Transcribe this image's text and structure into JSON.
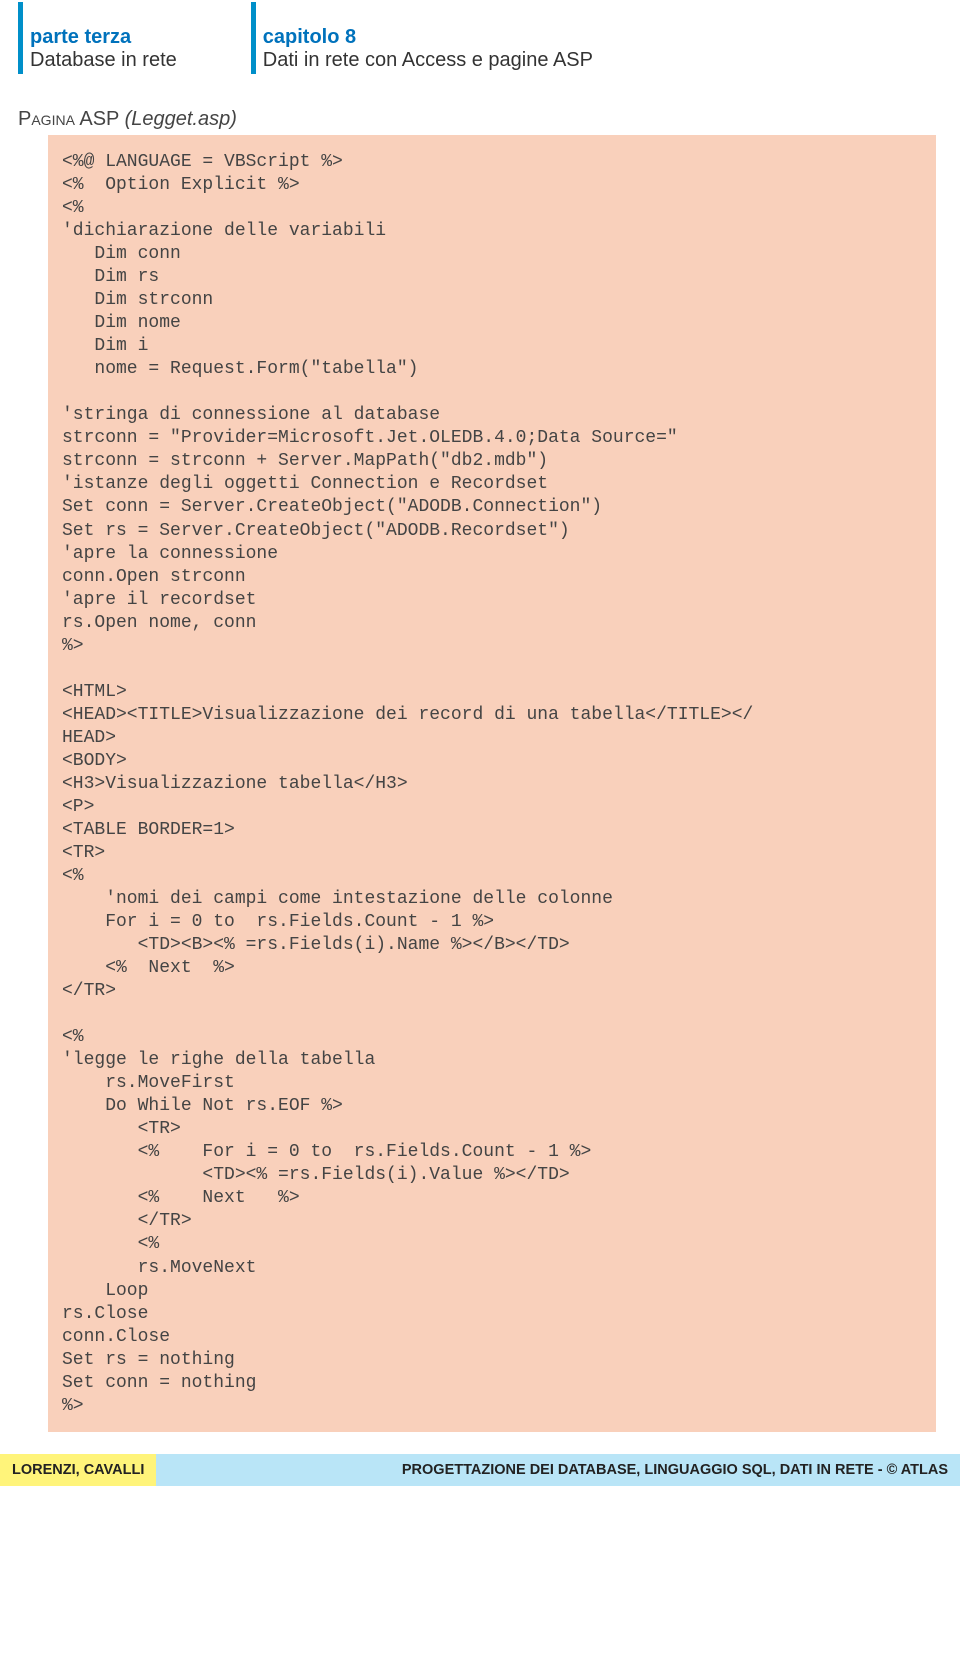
{
  "header": {
    "left_title": "parte terza",
    "left_sub": "Database in rete",
    "right_title": "capitolo 8",
    "right_sub": "Dati in rete con Access e pagine ASP"
  },
  "pagina_prefix": "Pagina",
  "pagina_asp": " ASP ",
  "pagina_file": "(Legget.asp)",
  "code": "<%@ LANGUAGE = VBScript %>\n<%  Option Explicit %>\n<%\n'dichiarazione delle variabili\n   Dim conn\n   Dim rs\n   Dim strconn\n   Dim nome\n   Dim i\n   nome = Request.Form(\"tabella\")\n\n'stringa di connessione al database\nstrconn = \"Provider=Microsoft.Jet.OLEDB.4.0;Data Source=\"\nstrconn = strconn + Server.MapPath(\"db2.mdb\")\n'istanze degli oggetti Connection e Recordset\nSet conn = Server.CreateObject(\"ADODB.Connection\")\nSet rs = Server.CreateObject(\"ADODB.Recordset\")\n'apre la connessione\nconn.Open strconn\n'apre il recordset\nrs.Open nome, conn\n%>\n\n<HTML>\n<HEAD><TITLE>Visualizzazione dei record di una tabella</TITLE></\nHEAD>\n<BODY>\n<H3>Visualizzazione tabella</H3>\n<P>\n<TABLE BORDER=1>\n<TR>\n<%\n    'nomi dei campi come intestazione delle colonne\n    For i = 0 to  rs.Fields.Count - 1 %>\n       <TD><B><% =rs.Fields(i).Name %></B></TD>\n    <%  Next  %>\n</TR>\n\n<%\n'legge le righe della tabella\n    rs.MoveFirst\n    Do While Not rs.EOF %>\n       <TR>\n       <%    For i = 0 to  rs.Fields.Count - 1 %>\n             <TD><% =rs.Fields(i).Value %></TD>\n       <%    Next   %>\n       </TR>\n       <%\n       rs.MoveNext\n    Loop\nrs.Close\nconn.Close\nSet rs = nothing\nSet conn = nothing\n%>",
  "footer": {
    "left": "LORENZI, CAVALLI",
    "right": "PROGETTAZIONE DEI DATABASE, LINGUAGGIO SQL, DATI IN RETE - © ATLAS"
  }
}
